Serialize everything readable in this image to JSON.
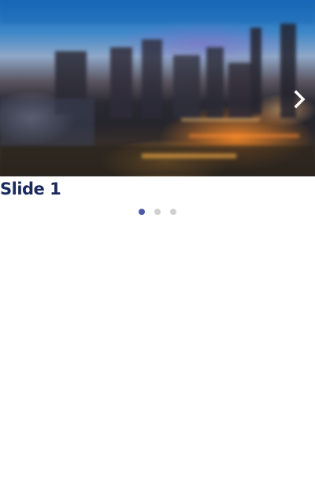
{
  "carousel": {
    "slides": [
      {
        "caption": "Slide 1",
        "image_subject": "city-skyline-at-dusk"
      }
    ],
    "active_index": 0,
    "dot_count": 3,
    "next_icon": "chevron-right-icon"
  },
  "colors": {
    "caption": "#1a2a5c",
    "dot_active": "#4a5aa8",
    "dot_inactive": "#d0d0d0"
  }
}
